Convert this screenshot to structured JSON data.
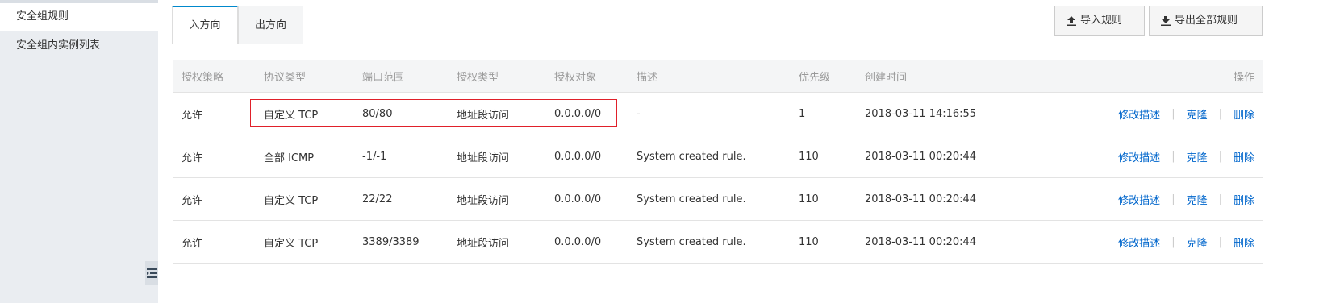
{
  "sidebar": {
    "items": [
      {
        "label": "安全组规则",
        "active": true
      },
      {
        "label": "安全组内实例列表",
        "active": false
      }
    ]
  },
  "tabs": [
    {
      "label": "入方向",
      "active": true
    },
    {
      "label": "出方向",
      "active": false
    }
  ],
  "toolbar": {
    "import_label": "导入规则",
    "export_label": "导出全部规则"
  },
  "table": {
    "headers": {
      "policy": "授权策略",
      "protocol": "协议类型",
      "port": "端口范围",
      "auth_type": "授权类型",
      "target": "授权对象",
      "description": "描述",
      "priority": "优先级",
      "created": "创建时间",
      "actions": "操作"
    },
    "rows": [
      {
        "policy": "允许",
        "protocol": "自定义 TCP",
        "port": "80/80",
        "auth_type": "地址段访问",
        "target": "0.0.0.0/0",
        "description": "-",
        "priority": "1",
        "created": "2018-03-11 14:16:55",
        "edit": "修改描述",
        "clone": "克隆",
        "delete": "删除"
      },
      {
        "policy": "允许",
        "protocol": "全部 ICMP",
        "port": "-1/-1",
        "auth_type": "地址段访问",
        "target": "0.0.0.0/0",
        "description": "System created rule.",
        "priority": "110",
        "created": "2018-03-11 00:20:44",
        "edit": "修改描述",
        "clone": "克隆",
        "delete": "删除"
      },
      {
        "policy": "允许",
        "protocol": "自定义 TCP",
        "port": "22/22",
        "auth_type": "地址段访问",
        "target": "0.0.0.0/0",
        "description": "System created rule.",
        "priority": "110",
        "created": "2018-03-11 00:20:44",
        "edit": "修改描述",
        "clone": "克隆",
        "delete": "删除"
      },
      {
        "policy": "允许",
        "protocol": "自定义 TCP",
        "port": "3389/3389",
        "auth_type": "地址段访问",
        "target": "0.0.0.0/0",
        "description": "System created rule.",
        "priority": "110",
        "created": "2018-03-11 00:20:44",
        "edit": "修改描述",
        "clone": "克隆",
        "delete": "删除"
      }
    ],
    "separator": "|"
  },
  "colors": {
    "link": "#0066cc",
    "tab_accent": "#0088cc",
    "highlight_box": "#e0202a",
    "sidebar_bg": "#eaedf1"
  },
  "icons": {
    "import": "upload-icon",
    "export": "download-icon",
    "collapse": "collapse-sidebar-icon"
  }
}
